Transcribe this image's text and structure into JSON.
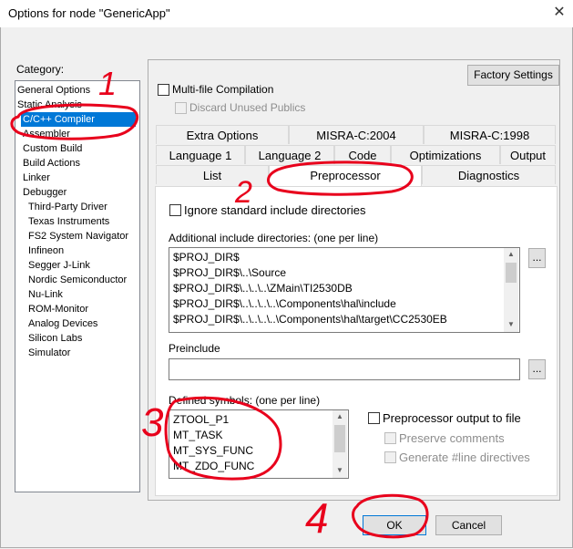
{
  "window": {
    "title": "Options for node \"GenericApp\"",
    "close_label": "✕"
  },
  "category": {
    "label": "Category:",
    "items": [
      "General Options",
      "Static Analysis",
      "C/C++ Compiler",
      "Assembler",
      "Custom Build",
      "Build Actions",
      "Linker",
      "Debugger",
      "Third-Party Driver",
      "Texas Instruments",
      "FS2 System Navigator",
      "Infineon",
      "Segger J-Link",
      "Nordic Semiconductor",
      "Nu-Link",
      "ROM-Monitor",
      "Analog Devices",
      "Silicon Labs",
      "Simulator"
    ],
    "selected": "C/C++ Compiler"
  },
  "factory_settings_label": "Factory Settings",
  "multi_file": {
    "label": "Multi-file Compilation",
    "checked": false
  },
  "discard_unused": {
    "label": "Discard Unused Publics",
    "checked": false,
    "disabled": true
  },
  "tabs": {
    "row1": [
      "Extra Options",
      "MISRA-C:2004",
      "MISRA-C:1998"
    ],
    "row2": [
      "Language 1",
      "Language 2",
      "Code",
      "Optimizations",
      "Output"
    ],
    "row3": [
      "List",
      "Preprocessor",
      "Diagnostics"
    ],
    "active": "Preprocessor"
  },
  "preprocessor": {
    "ignore_std_label": "Ignore standard include directories",
    "include_dirs_label": "Additional include directories: (one per line)",
    "include_dirs": [
      "$PROJ_DIR$",
      "$PROJ_DIR$\\..\\Source",
      "$PROJ_DIR$\\..\\..\\..\\ZMain\\TI2530DB",
      "$PROJ_DIR$\\..\\..\\..\\..\\Components\\hal\\include",
      "$PROJ_DIR$\\..\\..\\..\\..\\Components\\hal\\target\\CC2530EB"
    ],
    "browse_label": "...",
    "preinclude_label": "Preinclude",
    "preinclude_value": "",
    "defined_symbols_label": "Defined symbols: (one per line)",
    "defined_symbols": [
      "ZTOOL_P1",
      "MT_TASK",
      "MT_SYS_FUNC",
      "MT_ZDO_FUNC"
    ],
    "preproc_output_label": "Preprocessor output to file",
    "preserve_comments_label": "Preserve comments",
    "generate_line_label": "Generate #line directives"
  },
  "buttons": {
    "ok": "OK",
    "cancel": "Cancel"
  },
  "annotations": {
    "n1": "1",
    "n2": "2",
    "n3": "3",
    "n4": "4",
    "color": "#e8001c"
  }
}
